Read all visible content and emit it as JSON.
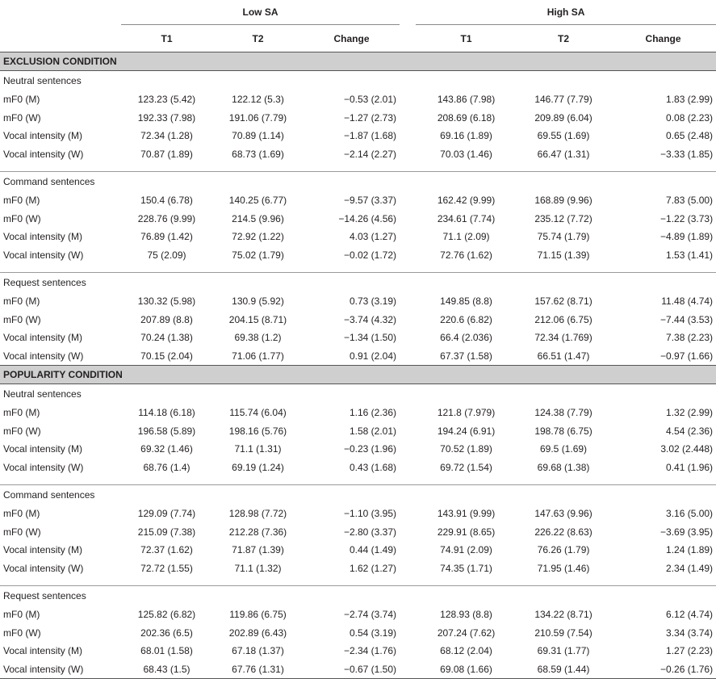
{
  "header": {
    "group_low": "Low SA",
    "group_high": "High SA",
    "columns": [
      "T1",
      "T2",
      "Change",
      "T1",
      "T2",
      "Change"
    ]
  },
  "conditions": [
    {
      "title": "EXCLUSION CONDITION",
      "blocks": [
        {
          "title": "Neutral sentences",
          "rows": [
            {
              "label": "mF0 (M)",
              "cells": [
                "123.23 (5.42)",
                "122.12 (5.3)",
                "−0.53 (2.01)",
                "143.86 (7.98)",
                "146.77 (7.79)",
                "1.83 (2.99)"
              ]
            },
            {
              "label": "mF0 (W)",
              "cells": [
                "192.33 (7.98)",
                "191.06 (7.79)",
                "−1.27 (2.73)",
                "208.69 (6.18)",
                "209.89 (6.04)",
                "0.08 (2.23)"
              ]
            },
            {
              "label": "Vocal intensity (M)",
              "cells": [
                "72.34 (1.28)",
                "70.89 (1.14)",
                "−1.87 (1.68)",
                "69.16 (1.89)",
                "69.55 (1.69)",
                "0.65 (2.48)"
              ]
            },
            {
              "label": "Vocal intensity (W)",
              "cells": [
                "70.87 (1.89)",
                "68.73 (1.69)",
                "−2.14 (2.27)",
                "70.03 (1.46)",
                "66.47 (1.31)",
                "−3.33 (1.85)"
              ]
            }
          ]
        },
        {
          "title": "Command sentences",
          "rows": [
            {
              "label": "mF0 (M)",
              "cells": [
                "150.4 (6.78)",
                "140.25 (6.77)",
                "−9.57 (3.37)",
                "162.42 (9.99)",
                "168.89 (9.96)",
                "7.83 (5.00)"
              ]
            },
            {
              "label": "mF0 (W)",
              "cells": [
                "228.76 (9.99)",
                "214.5 (9.96)",
                "−14.26 (4.56)",
                "234.61 (7.74)",
                "235.12 (7.72)",
                "−1.22 (3.73)"
              ]
            },
            {
              "label": "Vocal intensity (M)",
              "cells": [
                "76.89 (1.42)",
                "72.92 (1.22)",
                "4.03 (1.27)",
                "71.1 (2.09)",
                "75.74 (1.79)",
                "−4.89 (1.89)"
              ]
            },
            {
              "label": "Vocal intensity (W)",
              "cells": [
                "75 (2.09)",
                "75.02 (1.79)",
                "−0.02 (1.72)",
                "72.76 (1.62)",
                "71.15 (1.39)",
                "1.53 (1.41)"
              ]
            }
          ]
        },
        {
          "title": "Request sentences",
          "rows": [
            {
              "label": "mF0 (M)",
              "cells": [
                "130.32 (5.98)",
                "130.9 (5.92)",
                "0.73 (3.19)",
                "149.85 (8.8)",
                "157.62 (8.71)",
                "11.48 (4.74)"
              ]
            },
            {
              "label": "mF0 (W)",
              "cells": [
                "207.89 (8.8)",
                "204.15 (8.71)",
                "−3.74 (4.32)",
                "220.6 (6.82)",
                "212.06 (6.75)",
                "−7.44 (3.53)"
              ]
            },
            {
              "label": "Vocal intensity (M)",
              "cells": [
                "70.24 (1.38)",
                "69.38 (1.2)",
                "−1.34 (1.50)",
                "66.4 (2.036)",
                "72.34 (1.769)",
                "7.38 (2.23)"
              ]
            },
            {
              "label": "Vocal intensity (W)",
              "cells": [
                "70.15 (2.04)",
                "71.06 (1.77)",
                "0.91 (2.04)",
                "67.37 (1.58)",
                "66.51 (1.47)",
                "−0.97 (1.66)"
              ]
            }
          ]
        }
      ]
    },
    {
      "title": "POPULARITY CONDITION",
      "blocks": [
        {
          "title": "Neutral sentences",
          "rows": [
            {
              "label": "mF0 (M)",
              "cells": [
                "114.18 (6.18)",
                "115.74 (6.04)",
                "1.16 (2.36)",
                "121.8 (7.979)",
                "124.38 (7.79)",
                "1.32 (2.99)"
              ]
            },
            {
              "label": "mF0 (W)",
              "cells": [
                "196.58 (5.89)",
                "198.16 (5.76)",
                "1.58 (2.01)",
                "194.24 (6.91)",
                "198.78 (6.75)",
                "4.54 (2.36)"
              ]
            },
            {
              "label": "Vocal intensity (M)",
              "cells": [
                "69.32 (1.46)",
                "71.1 (1.31)",
                "−0.23 (1.96)",
                "70.52 (1.89)",
                "69.5 (1.69)",
                "3.02 (2.448)"
              ]
            },
            {
              "label": "Vocal intensity (W)",
              "cells": [
                "68.76 (1.4)",
                "69.19 (1.24)",
                "0.43 (1.68)",
                "69.72 (1.54)",
                "69.68 (1.38)",
                "0.41 (1.96)"
              ]
            }
          ]
        },
        {
          "title": "Command sentences",
          "rows": [
            {
              "label": "mF0 (M)",
              "cells": [
                "129.09 (7.74)",
                "128.98 (7.72)",
                "−1.10 (3.95)",
                "143.91 (9.99)",
                "147.63 (9.96)",
                "3.16 (5.00)"
              ]
            },
            {
              "label": "mF0 (W)",
              "cells": [
                "215.09 (7.38)",
                "212.28 (7.36)",
                "−2.80 (3.37)",
                "229.91 (8.65)",
                "226.22 (8.63)",
                "−3.69 (3.95)"
              ]
            },
            {
              "label": "Vocal intensity (M)",
              "cells": [
                "72.37 (1.62)",
                "71.87 (1.39)",
                "0.44 (1.49)",
                "74.91 (2.09)",
                "76.26 (1.79)",
                "1.24 (1.89)"
              ]
            },
            {
              "label": "Vocal intensity (W)",
              "cells": [
                "72.72 (1.55)",
                "71.1 (1.32)",
                "1.62 (1.27)",
                "74.35 (1.71)",
                "71.95 (1.46)",
                "2.34 (1.49)"
              ]
            }
          ]
        },
        {
          "title": "Request sentences",
          "rows": [
            {
              "label": "mF0 (M)",
              "cells": [
                "125.82 (6.82)",
                "119.86 (6.75)",
                "−2.74 (3.74)",
                "128.93 (8.8)",
                "134.22 (8.71)",
                "6.12 (4.74)"
              ]
            },
            {
              "label": "mF0 (W)",
              "cells": [
                "202.36 (6.5)",
                "202.89 (6.43)",
                "0.54 (3.19)",
                "207.24 (7.62)",
                "210.59 (7.54)",
                "3.34 (3.74)"
              ]
            },
            {
              "label": "Vocal intensity (M)",
              "cells": [
                "68.01 (1.58)",
                "67.18 (1.37)",
                "−2.34 (1.76)",
                "68.12 (2.04)",
                "69.31 (1.77)",
                "1.27 (2.23)"
              ]
            },
            {
              "label": "Vocal intensity (W)",
              "cells": [
                "68.43 (1.5)",
                "67.76 (1.31)",
                "−0.67 (1.50)",
                "69.08 (1.66)",
                "68.59 (1.44)",
                "−0.26 (1.76)"
              ]
            }
          ]
        }
      ]
    }
  ]
}
